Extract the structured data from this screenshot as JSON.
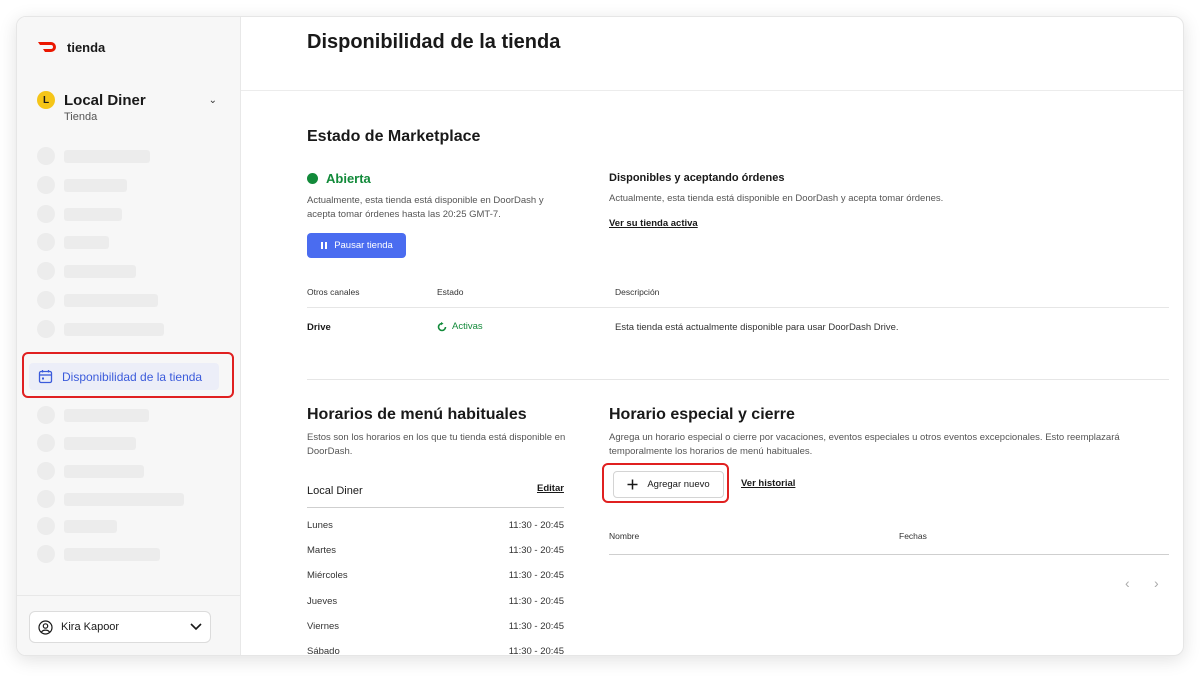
{
  "brand": {
    "name": "tienda",
    "color": "#eb1700"
  },
  "store": {
    "initial": "L",
    "name": "Local Diner",
    "type": "Tienda"
  },
  "nav": {
    "active_label": "Disponibilidad de la tienda",
    "accent": "#3b5bdb"
  },
  "user": {
    "name": "Kira Kapoor"
  },
  "page": {
    "title": "Disponibilidad de la tienda"
  },
  "marketplace": {
    "heading": "Estado de Marketplace",
    "status": "Abierta",
    "status_color": "#128a3a",
    "description": "Actualmente, esta tienda está disponible en DoorDash y acepta tomar órdenes hasta las 20:25 GMT-7.",
    "pause_button": "Pausar tienda",
    "right_title": "Disponibles y aceptando órdenes",
    "right_desc": "Actualmente, esta tienda está disponible en DoorDash y acepta tomar órdenes.",
    "right_link": "Ver su tienda activa"
  },
  "channels": {
    "headers": [
      "Otros canales",
      "Estado",
      "Descripción"
    ],
    "rows": [
      {
        "channel": "Drive",
        "status": "Activas",
        "description": "Esta tienda está actualmente disponible para usar DoorDash Drive."
      }
    ]
  },
  "menu_hours": {
    "heading": "Horarios de menú habituales",
    "description": "Estos son los horarios en los que tu tienda está disponible en DoorDash.",
    "menu_name": "Local Diner",
    "edit_label": "Editar",
    "days": [
      {
        "day": "Lunes",
        "hours": "11:30 - 20:45"
      },
      {
        "day": "Martes",
        "hours": "11:30 - 20:45"
      },
      {
        "day": "Miércoles",
        "hours": "11:30 - 20:45"
      },
      {
        "day": "Jueves",
        "hours": "11:30 - 20:45"
      },
      {
        "day": "Viernes",
        "hours": "11:30 - 20:45"
      },
      {
        "day": "Sábado",
        "hours": "11:30 - 20:45"
      }
    ]
  },
  "special_hours": {
    "heading": "Horario especial y cierre",
    "description": "Agrega un horario especial o cierre por vacaciones, eventos especiales u otros eventos excepcionales. Esto reemplazará temporalmente los horarios de menú habituales.",
    "add_button": "Agregar nuevo",
    "history_link": "Ver historial",
    "table_headers": [
      "Nombre",
      "Fechas"
    ]
  }
}
